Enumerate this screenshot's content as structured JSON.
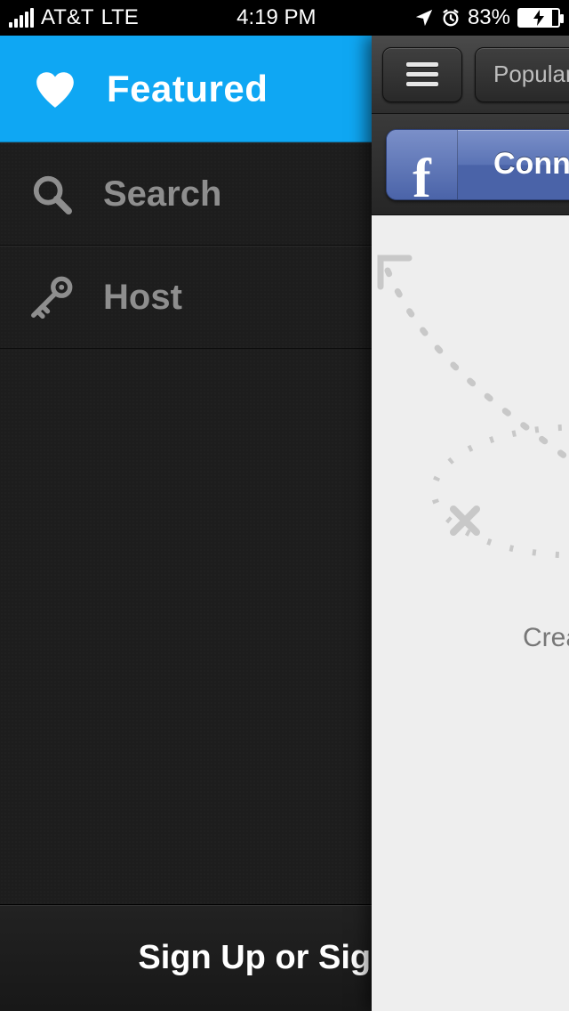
{
  "status_bar": {
    "carrier": "AT&T",
    "network": "LTE",
    "time": "4:19 PM",
    "battery_pct": "83%"
  },
  "sidemenu": {
    "header": {
      "title": "Featured"
    },
    "items": [
      {
        "label": "Search"
      },
      {
        "label": "Host"
      }
    ],
    "footer": {
      "label": "Sign Up or Sign In"
    }
  },
  "main_panel": {
    "topbar": {
      "popular_label": "Popular"
    },
    "facebook": {
      "connect_label": "Connect",
      "letter": "f"
    },
    "body": {
      "hint_text": "Create"
    }
  }
}
